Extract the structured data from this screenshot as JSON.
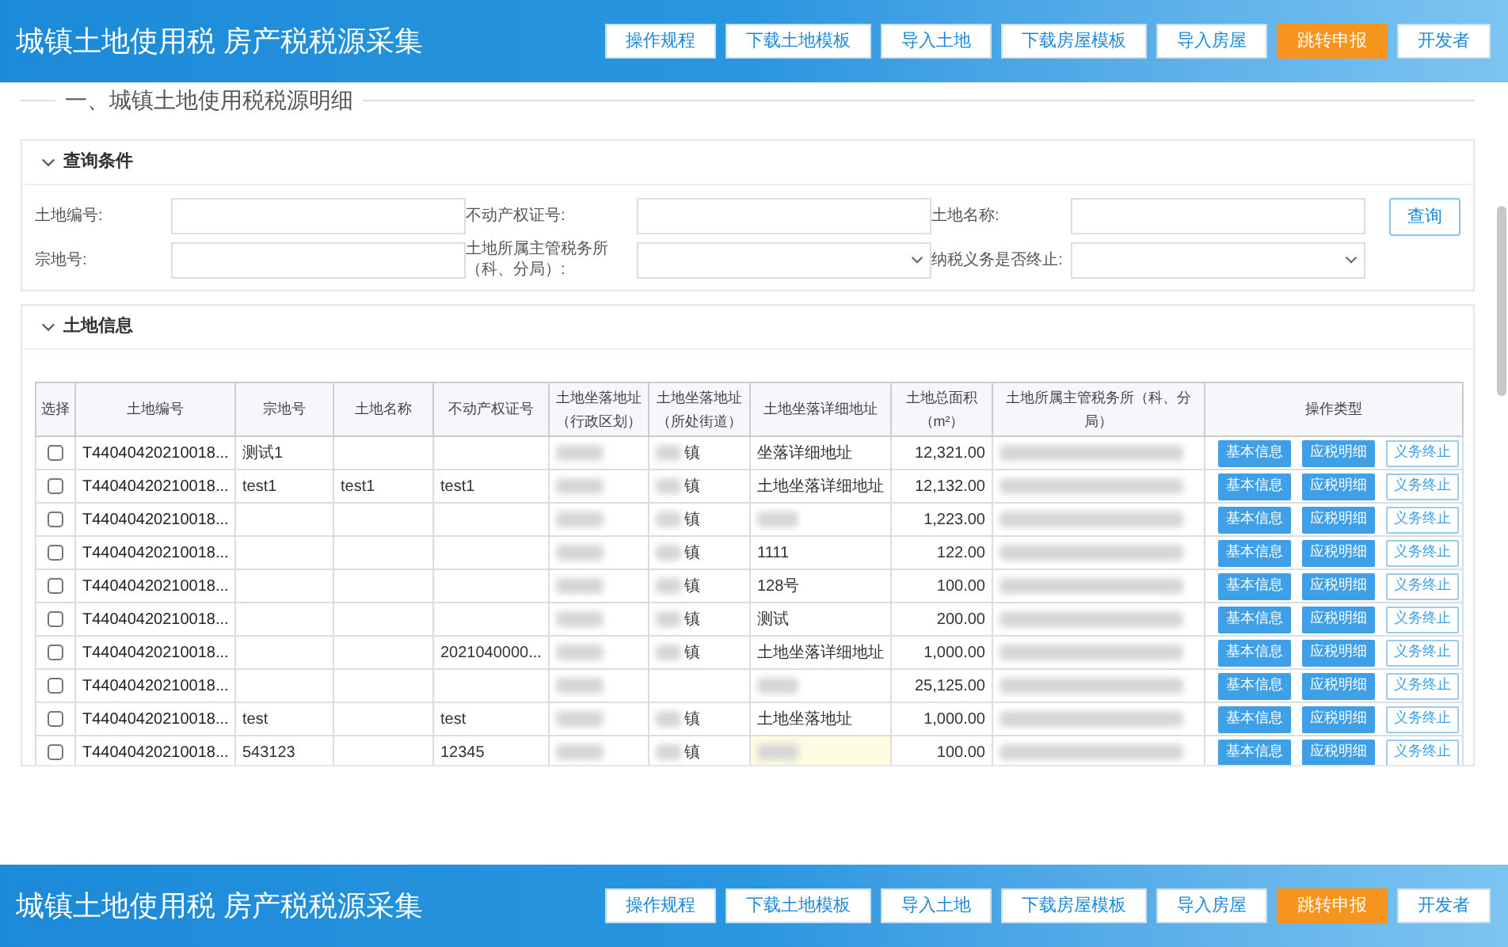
{
  "header": {
    "title": "城镇土地使用税 房产税税源采集",
    "buttons": [
      {
        "label": "操作规程",
        "kind": "plain"
      },
      {
        "label": "下载土地模板",
        "kind": "plain"
      },
      {
        "label": "导入土地",
        "kind": "plain"
      },
      {
        "label": "下载房屋模板",
        "kind": "plain"
      },
      {
        "label": "导入房屋",
        "kind": "plain"
      },
      {
        "label": "跳转申报",
        "kind": "primary"
      },
      {
        "label": "开发者",
        "kind": "plain"
      }
    ]
  },
  "section_title": "一、城镇土地使用税税源明细",
  "query_panel": {
    "title": "查询条件",
    "expanded": true,
    "fields": [
      {
        "label": "土地编号:",
        "kind": "input"
      },
      {
        "label": "不动产权证号:",
        "kind": "input"
      },
      {
        "label": "土地名称:",
        "kind": "input"
      },
      {
        "label": "宗地号:",
        "kind": "input"
      },
      {
        "label": "土地所属主管税务所（科、分局）:",
        "kind": "select"
      },
      {
        "label": "纳税义务是否终止:",
        "kind": "select"
      }
    ],
    "search_button": "查询"
  },
  "land_panel": {
    "title": "土地信息",
    "expanded": true,
    "table": {
      "columns": [
        "选择",
        "土地编号",
        "宗地号",
        "土地名称",
        "不动产权证号",
        "土地坐落地址（行政区划）",
        "土地坐落地址（所处街道）",
        "土地坐落详细地址",
        "土地总面积（m²）",
        "土地所属主管税务所（科、分局）",
        "操作类型"
      ],
      "rows": [
        {
          "checked": false,
          "land_no": "T44040420210018...",
          "parcel_no": "测试1",
          "land_name": "",
          "cert_no": "",
          "street": "镇",
          "detail": "坐落详细地址",
          "detail_redacted": false,
          "highlighted": false,
          "area": "12,321.00",
          "actions": [
            {
              "label": "基本信息",
              "kind": "primary"
            },
            {
              "label": "应税明细",
              "kind": "primary"
            },
            {
              "label": "义务终止",
              "kind": "outline"
            }
          ]
        },
        {
          "checked": false,
          "land_no": "T44040420210018...",
          "parcel_no": "test1",
          "land_name": "test1",
          "cert_no": "test1",
          "street": "镇",
          "detail": "土地坐落详细地址",
          "detail_redacted": false,
          "highlighted": false,
          "area": "12,132.00",
          "actions": [
            {
              "label": "基本信息",
              "kind": "primary"
            },
            {
              "label": "应税明细",
              "kind": "primary"
            },
            {
              "label": "义务终止",
              "kind": "outline"
            }
          ]
        },
        {
          "checked": false,
          "land_no": "T44040420210018...",
          "parcel_no": "",
          "land_name": "",
          "cert_no": "",
          "street": "镇",
          "detail": "",
          "detail_redacted": true,
          "highlighted": false,
          "area": "1,223.00",
          "actions": [
            {
              "label": "基本信息",
              "kind": "primary"
            },
            {
              "label": "应税明细",
              "kind": "primary"
            },
            {
              "label": "义务终止",
              "kind": "outline"
            }
          ]
        },
        {
          "checked": false,
          "land_no": "T44040420210018...",
          "parcel_no": "",
          "land_name": "",
          "cert_no": "",
          "street": "镇",
          "detail": "1111",
          "detail_redacted": false,
          "highlighted": false,
          "area": "122.00",
          "actions": [
            {
              "label": "基本信息",
              "kind": "primary"
            },
            {
              "label": "应税明细",
              "kind": "primary"
            },
            {
              "label": "义务终止",
              "kind": "outline"
            }
          ]
        },
        {
          "checked": false,
          "land_no": "T44040420210018...",
          "parcel_no": "",
          "land_name": "",
          "cert_no": "",
          "street": "镇",
          "detail": "128号",
          "detail_redacted": false,
          "highlighted": false,
          "area": "100.00",
          "actions": [
            {
              "label": "基本信息",
              "kind": "primary"
            },
            {
              "label": "应税明细",
              "kind": "primary"
            },
            {
              "label": "义务终止",
              "kind": "outline"
            }
          ]
        },
        {
          "checked": false,
          "land_no": "T44040420210018...",
          "parcel_no": "",
          "land_name": "",
          "cert_no": "",
          "street": "镇",
          "detail": "测试",
          "detail_redacted": false,
          "highlighted": false,
          "area": "200.00",
          "actions": [
            {
              "label": "基本信息",
              "kind": "primary"
            },
            {
              "label": "应税明细",
              "kind": "primary"
            },
            {
              "label": "义务终止",
              "kind": "outline"
            }
          ]
        },
        {
          "checked": false,
          "land_no": "T44040420210018...",
          "parcel_no": "",
          "land_name": "",
          "cert_no": "2021040000...",
          "street": "镇",
          "detail": "土地坐落详细地址",
          "detail_redacted": false,
          "highlighted": false,
          "area": "1,000.00",
          "actions": [
            {
              "label": "基本信息",
              "kind": "primary"
            },
            {
              "label": "应税明细",
              "kind": "primary"
            },
            {
              "label": "义务终止",
              "kind": "outline"
            }
          ]
        },
        {
          "checked": false,
          "land_no": "T44040420210018...",
          "parcel_no": "",
          "land_name": "",
          "cert_no": "",
          "street": "",
          "detail": "",
          "detail_redacted": true,
          "highlighted": false,
          "area": "25,125.00",
          "actions": [
            {
              "label": "基本信息",
              "kind": "primary"
            },
            {
              "label": "应税明细",
              "kind": "primary"
            },
            {
              "label": "义务终止",
              "kind": "outline"
            }
          ]
        },
        {
          "checked": false,
          "land_no": "T44040420210018...",
          "parcel_no": "test",
          "land_name": "",
          "cert_no": "test",
          "street": "镇",
          "detail": "土地坐落地址",
          "detail_redacted": false,
          "highlighted": false,
          "area": "1,000.00",
          "actions": [
            {
              "label": "基本信息",
              "kind": "primary"
            },
            {
              "label": "应税明细",
              "kind": "primary"
            },
            {
              "label": "义务终止",
              "kind": "outline"
            }
          ]
        },
        {
          "checked": false,
          "land_no": "T44040420210018...",
          "parcel_no": "543123",
          "land_name": "",
          "cert_no": "12345",
          "street": "镇",
          "detail": "",
          "detail_redacted": true,
          "highlighted": true,
          "area": "100.00",
          "actions": [
            {
              "label": "基本信息",
              "kind": "primary"
            },
            {
              "label": "应税明细",
              "kind": "primary"
            },
            {
              "label": "义务终止",
              "kind": "outline"
            }
          ]
        }
      ]
    }
  },
  "footer_header": {
    "title": "城镇土地使用税 房产税税源采集",
    "buttons": [
      {
        "label": "操作规程",
        "kind": "plain"
      },
      {
        "label": "下载土地模板",
        "kind": "plain"
      },
      {
        "label": "导入土地",
        "kind": "plain"
      },
      {
        "label": "下载房屋模板",
        "kind": "plain"
      },
      {
        "label": "导入房屋",
        "kind": "plain"
      },
      {
        "label": "跳转申报",
        "kind": "primary"
      },
      {
        "label": "开发者",
        "kind": "plain"
      }
    ]
  }
}
